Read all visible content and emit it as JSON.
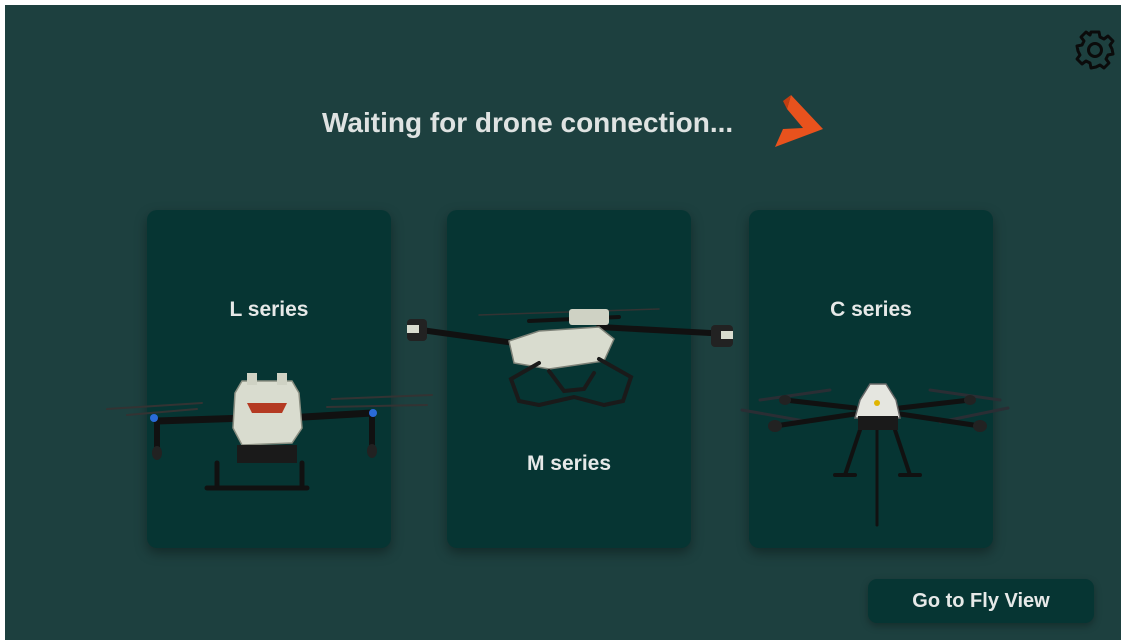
{
  "header": {
    "status_text": "Waiting for drone connection...",
    "brand_logo_icon": "orange-play-triangle-logo",
    "settings_icon": "gear-icon"
  },
  "drone_series": [
    {
      "label": "L series",
      "icon": "l-series-drone-image"
    },
    {
      "label": "M series",
      "icon": "m-series-drone-image"
    },
    {
      "label": "C series",
      "icon": "c-series-drone-image"
    }
  ],
  "footer": {
    "fly_view_label": "Go to Fly View"
  },
  "colors": {
    "background": "#1d403f",
    "card": "#063533",
    "text": "#e6e9e8",
    "accent": "#e8521d"
  }
}
